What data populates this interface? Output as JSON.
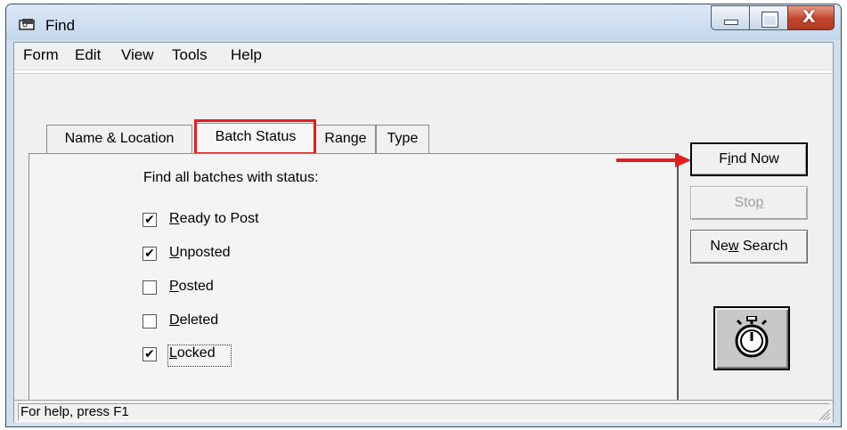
{
  "window": {
    "title": "Find",
    "close_glyph": "X"
  },
  "menu": [
    "Form",
    "Edit",
    "View",
    "Tools",
    "Help"
  ],
  "tabs": [
    {
      "label": "Name & Location",
      "active": false
    },
    {
      "label": "Batch Status",
      "active": true
    },
    {
      "label": "Range",
      "active": false
    },
    {
      "label": "Type",
      "active": false
    }
  ],
  "panel": {
    "heading": "Find all batches with status:",
    "checkboxes": [
      {
        "pre": "",
        "accel": "R",
        "post": "eady to Post",
        "checked": true
      },
      {
        "pre": "",
        "accel": "U",
        "post": "nposted",
        "checked": true
      },
      {
        "pre": "",
        "accel": "P",
        "post": "osted",
        "checked": false
      },
      {
        "pre": "",
        "accel": "D",
        "post": "eleted",
        "checked": false
      },
      {
        "pre": "",
        "accel": "L",
        "post": "ocked",
        "checked": true
      }
    ]
  },
  "buttons": {
    "find_now": {
      "pre": "F",
      "accel": "i",
      "post": "nd Now"
    },
    "stop": {
      "pre": "Sto",
      "accel": "p",
      "post": ""
    },
    "new_search": {
      "pre": "Ne",
      "accel": "w",
      "post": " Search"
    }
  },
  "status": {
    "text": "For help, press F1"
  },
  "icons": {
    "app": "find-app-icon",
    "timer": "stopwatch-icon",
    "check": "checkmark-icon"
  },
  "colors": {
    "highlight": "#e01e1e",
    "close_button": "#c1442c",
    "title_bar": "#c3d6eb"
  }
}
